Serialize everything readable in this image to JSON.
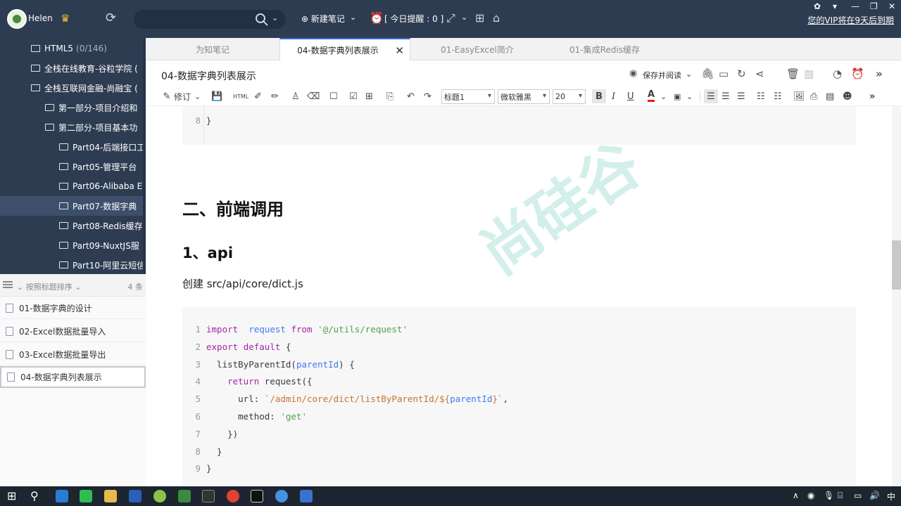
{
  "user": {
    "name": "Helen"
  },
  "top_bar": {
    "new_note": "⊕ 新建笔记",
    "reminder": "[ 今日提醒 : 0 ]",
    "vip_notice": "您的VIP将在9天后到期"
  },
  "tree": [
    {
      "label": "HTML5",
      "count": "(0/146)"
    },
    {
      "label": "全栈在线教育-谷粒学院 (",
      "count": ""
    },
    {
      "label": "全栈互联网金融-尚融宝 (",
      "count": ""
    },
    {
      "label": "第一部分-项目介绍和",
      "count": ""
    },
    {
      "label": "第二部分-项目基本功",
      "count": ""
    },
    {
      "label": "Part04-后端接口工",
      "count": ""
    },
    {
      "label": "Part05-管理平台",
      "count": ""
    },
    {
      "label": "Part06-Alibaba E",
      "count": ""
    },
    {
      "label": "Part07-数据字典",
      "count": ""
    },
    {
      "label": "Part08-Redis缓存",
      "count": ""
    },
    {
      "label": "Part09-NuxtJS服",
      "count": ""
    },
    {
      "label": "Part10-阿里云短信",
      "count": ""
    }
  ],
  "note_list": {
    "sort_label": "按照标题排序",
    "count": "4 条",
    "items": [
      "01-数据字典的设计",
      "02-Excel数据批量导入",
      "03-Excel数据批量导出",
      "04-数据字典列表展示"
    ]
  },
  "tabs": [
    "为知笔记",
    "04-数据字典列表展示",
    "01-EasyExcel简介",
    "01-集成Redis缓存"
  ],
  "doc": {
    "title": "04-数据字典列表展示",
    "save_read": "保存并阅读",
    "heading2": "二、前端调用",
    "heading3": "1、api",
    "para": "创建 src/api/core/dict.js",
    "code_top_line": "8",
    "code_top_text": "}",
    "watermark": "尚硅谷"
  },
  "toolbar": {
    "revise": "修订",
    "html": "HTML",
    "heading_select": "标题1",
    "font_select": "微软雅黑",
    "size_select": "20"
  },
  "code": [
    {
      "n": "1",
      "parts": [
        [
          "kw",
          "import"
        ],
        [
          "",
          "  "
        ],
        [
          "fn",
          "request"
        ],
        [
          "",
          ""
        ],
        [
          "kw",
          " from"
        ],
        [
          "",
          " "
        ],
        [
          "str",
          "'@/utils/request'"
        ]
      ]
    },
    {
      "n": "2",
      "parts": [
        [
          "kw",
          "export"
        ],
        [
          "",
          " "
        ],
        [
          "kw",
          "default"
        ],
        [
          "",
          " {"
        ]
      ]
    },
    {
      "n": "3",
      "parts": [
        [
          "",
          "  listByParentId("
        ],
        [
          "var",
          "parentId"
        ],
        [
          "",
          ") {"
        ]
      ]
    },
    {
      "n": "4",
      "parts": [
        [
          "",
          "    "
        ],
        [
          "kw",
          "return"
        ],
        [
          "",
          " request({"
        ]
      ]
    },
    {
      "n": "5",
      "parts": [
        [
          "",
          "      url: "
        ],
        [
          "tpl",
          "`/admin/core/dict/listByParentId/${"
        ],
        [
          "var",
          "parentId"
        ],
        [
          "tpl",
          "}`"
        ],
        [
          "",
          ","
        ]
      ]
    },
    {
      "n": "6",
      "parts": [
        [
          "",
          "      method: "
        ],
        [
          "str",
          "'get'"
        ]
      ]
    },
    {
      "n": "7",
      "parts": [
        [
          "",
          "    })"
        ]
      ]
    },
    {
      "n": "8",
      "parts": [
        [
          "",
          "  }"
        ]
      ]
    },
    {
      "n": "9",
      "parts": [
        [
          "",
          "}"
        ]
      ]
    }
  ],
  "taskbar": {
    "ime": "中"
  }
}
